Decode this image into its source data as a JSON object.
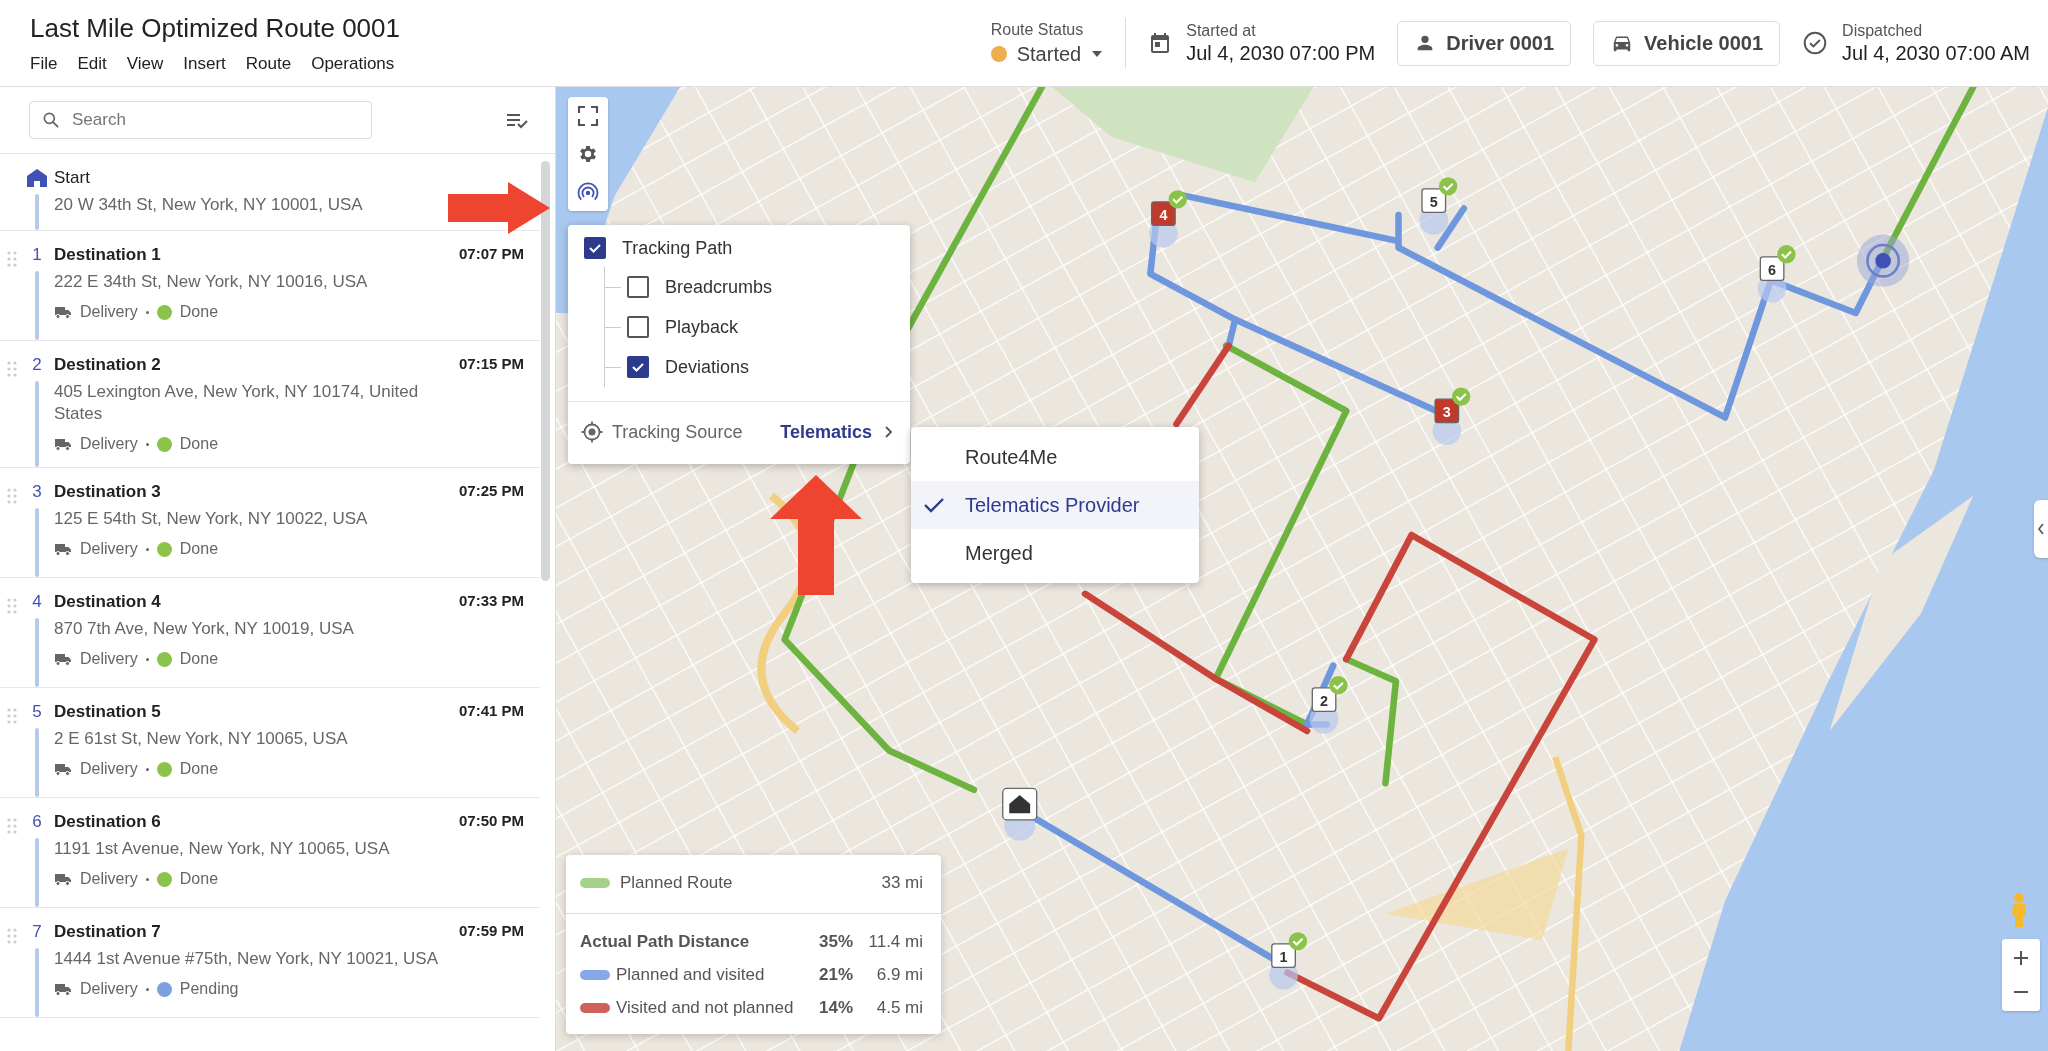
{
  "window": {
    "title": "Last Mile Optimized Route 0001"
  },
  "menu": [
    "File",
    "Edit",
    "View",
    "Insert",
    "Route",
    "Operations"
  ],
  "header": {
    "route_status": {
      "label": "Route Status",
      "value": "Started"
    },
    "started": {
      "label": "Started at",
      "value": "Jul 4, 2030 07:00 PM"
    },
    "driver": "Driver 0001",
    "vehicle": "Vehicle 0001",
    "dispatched": {
      "label": "Dispatched",
      "value": "Jul 4, 2030 07:00 AM"
    }
  },
  "sidebar": {
    "search": {
      "placeholder": "Search"
    },
    "start": {
      "name": "Start",
      "address": "20 W 34th St, New York, NY 10001, USA"
    },
    "stops": [
      {
        "number": "1",
        "name": "Destination 1",
        "time": "07:07 PM",
        "address": "222 E 34th St, New York, NY 10016, USA",
        "type": "Delivery",
        "status": "Done",
        "color": "#8bc34a"
      },
      {
        "number": "2",
        "name": "Destination 2",
        "time": "07:15 PM",
        "address": "405 Lexington Ave, New York, NY 10174, United States",
        "type": "Delivery",
        "status": "Done",
        "color": "#8bc34a"
      },
      {
        "number": "3",
        "name": "Destination 3",
        "time": "07:25 PM",
        "address": "125 E 54th St, New York, NY 10022, USA",
        "type": "Delivery",
        "status": "Done",
        "color": "#8bc34a"
      },
      {
        "number": "4",
        "name": "Destination 4",
        "time": "07:33 PM",
        "address": "870 7th Ave, New York, NY 10019, USA",
        "type": "Delivery",
        "status": "Done",
        "color": "#8bc34a"
      },
      {
        "number": "5",
        "name": "Destination 5",
        "time": "07:41 PM",
        "address": "2 E 61st St, New York, NY 10065, USA",
        "type": "Delivery",
        "status": "Done",
        "color": "#8bc34a"
      },
      {
        "number": "6",
        "name": "Destination 6",
        "time": "07:50 PM",
        "address": "1191 1st Avenue, New York, NY 10065, USA",
        "type": "Delivery",
        "status": "Done",
        "color": "#8bc34a"
      },
      {
        "number": "7",
        "name": "Destination 7",
        "time": "07:59 PM",
        "address": "1444 1st Avenue #75th, New York, NY 10021, USA",
        "type": "Delivery",
        "status": "Pending",
        "color": "#7b9fe0"
      }
    ]
  },
  "map": {
    "markers": [
      {
        "label": "1",
        "kind": "stop",
        "done": true
      },
      {
        "label": "2",
        "kind": "stop",
        "done": true
      },
      {
        "label": "3",
        "kind": "deviation",
        "done": true
      },
      {
        "label": "4",
        "kind": "deviation",
        "done": true
      },
      {
        "label": "5",
        "kind": "stop",
        "done": true
      },
      {
        "label": "6",
        "kind": "stop",
        "done": true
      }
    ],
    "tracking_menu": {
      "label": "Tracking Path",
      "checked": true,
      "children": [
        {
          "label": "Breadcrumbs",
          "checked": false
        },
        {
          "label": "Playback",
          "checked": false
        },
        {
          "label": "Deviations",
          "checked": true
        }
      ],
      "source_label": "Tracking Source",
      "source_value": "Telematics"
    },
    "source_menu": [
      {
        "label": "Route4Me",
        "selected": false
      },
      {
        "label": "Telematics Provider",
        "selected": true
      },
      {
        "label": "Merged",
        "selected": false
      }
    ],
    "legend": {
      "planned": {
        "label": "Planned Route",
        "distance": "33 mi",
        "color": "#a5d18a"
      },
      "actual": {
        "label": "Actual Path Distance",
        "percent": "35%",
        "distance": "11.4 mi"
      },
      "rows": [
        {
          "label": "Planned and visited",
          "percent": "21%",
          "distance": "6.9 mi",
          "color": "#86a8e8"
        },
        {
          "label": "Visited and not planned",
          "percent": "14%",
          "distance": "4.5 mi",
          "color": "#d0605a"
        }
      ]
    }
  }
}
